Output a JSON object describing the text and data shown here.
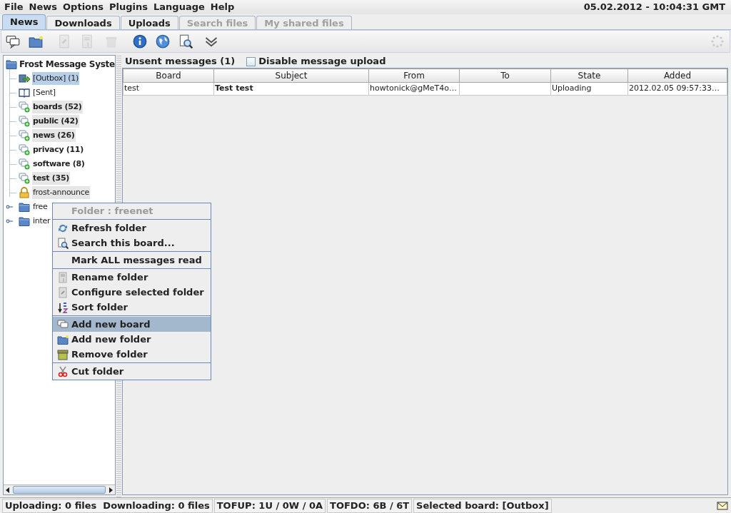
{
  "menu_bar": [
    "File",
    "News",
    "Options",
    "Plugins",
    "Language",
    "Help"
  ],
  "clock": "05.02.2012 - 10:04:31 GMT",
  "tabs": [
    {
      "label": "News",
      "selected": true,
      "disabled": false
    },
    {
      "label": "Downloads",
      "selected": false,
      "disabled": false
    },
    {
      "label": "Uploads",
      "selected": false,
      "disabled": false
    },
    {
      "label": "Search files",
      "selected": false,
      "disabled": true
    },
    {
      "label": "My shared files",
      "selected": false,
      "disabled": true
    }
  ],
  "toolbar": [
    {
      "kind": "message",
      "disabled": false
    },
    {
      "kind": "folder",
      "disabled": false
    },
    {
      "kind": "configure",
      "disabled": true
    },
    {
      "kind": "rename",
      "disabled": true
    },
    {
      "kind": "trash",
      "disabled": true
    },
    {
      "kind": "info",
      "disabled": false
    },
    {
      "kind": "globe",
      "disabled": false
    },
    {
      "kind": "search",
      "disabled": false
    },
    {
      "kind": "chevron",
      "disabled": false
    }
  ],
  "tree": {
    "label": "Frost Message Syste",
    "children": [
      {
        "kind": "outbox",
        "label": "[Outbox] (1)",
        "selected": true,
        "bold": false
      },
      {
        "kind": "sent",
        "label": "[Sent]",
        "selected": false,
        "bold": false,
        "highlighted": false
      },
      {
        "kind": "board",
        "label": "boards (52)",
        "selected": false,
        "bold": true,
        "highlighted": true
      },
      {
        "kind": "board",
        "label": "public (42)",
        "selected": false,
        "bold": true,
        "highlighted": true
      },
      {
        "kind": "board",
        "label": "news (26)",
        "selected": false,
        "bold": true,
        "highlighted": true
      },
      {
        "kind": "board",
        "label": "privacy (11)",
        "selected": false,
        "bold": true,
        "highlighted": false
      },
      {
        "kind": "board",
        "label": "software (8)",
        "selected": false,
        "bold": true,
        "highlighted": false
      },
      {
        "kind": "board",
        "label": "test (35)",
        "selected": false,
        "bold": true,
        "highlighted": true
      },
      {
        "kind": "locked",
        "label": "frost-announce",
        "selected": false,
        "bold": false,
        "highlighted": true
      },
      {
        "kind": "folder",
        "label": "free",
        "selected": false,
        "bold": false,
        "highlighted": false,
        "expanded": false
      },
      {
        "kind": "folder",
        "label": "inter",
        "selected": false,
        "bold": false,
        "highlighted": false,
        "expanded": false
      }
    ]
  },
  "panel": {
    "title": "Unsent messages (1)",
    "checkbox": {
      "label": "Disable message upload",
      "checked": false
    }
  },
  "table": {
    "columns": [
      "Board",
      "Subject",
      "From",
      "To",
      "State",
      "Added"
    ],
    "rows": [
      [
        "test",
        "Test test",
        "howtonick@gMeT4o…",
        "",
        "Uploading",
        "2012.02.05 09:57:33…"
      ]
    ]
  },
  "context_menu": [
    {
      "kind": "header",
      "label": "Folder : freenet"
    },
    {
      "kind": "separator"
    },
    {
      "kind": "refresh",
      "label": "Refresh folder",
      "selected": false
    },
    {
      "kind": "search",
      "label": "Search this board...",
      "selected": false
    },
    {
      "kind": "separator"
    },
    {
      "kind": "plain",
      "label": "Mark ALL messages read",
      "selected": false
    },
    {
      "kind": "separator"
    },
    {
      "kind": "rename",
      "label": "Rename folder",
      "selected": false
    },
    {
      "kind": "configure",
      "label": "Configure selected folder",
      "selected": false
    },
    {
      "kind": "sort",
      "label": "Sort folder",
      "selected": false
    },
    {
      "kind": "separator"
    },
    {
      "kind": "board",
      "label": "Add new board",
      "selected": true
    },
    {
      "kind": "folder",
      "label": "Add new folder",
      "selected": false
    },
    {
      "kind": "trash",
      "label": "Remove folder",
      "selected": false
    },
    {
      "kind": "separator"
    },
    {
      "kind": "scissors",
      "label": "Cut folder",
      "selected": false
    }
  ],
  "status_bar": [
    "Uploading: 0 files  Downloading: 0 files",
    "TOFUP: 1U / 0W / 0A",
    "TOFDO: 6B / 6T",
    "Selected board: [Outbox]"
  ]
}
